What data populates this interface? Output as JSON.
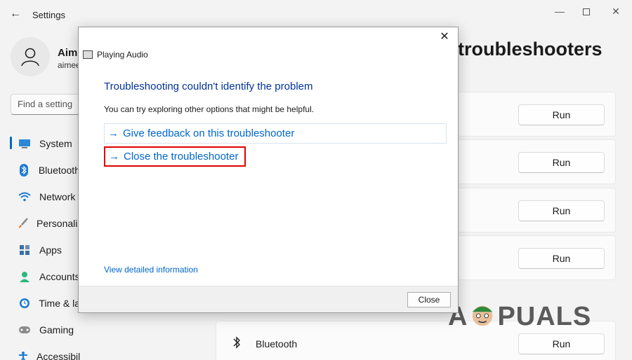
{
  "window": {
    "title": "Settings",
    "back_glyph": "←",
    "minimize_glyph": "—",
    "close_glyph": "✕"
  },
  "profile": {
    "name": "Aime",
    "email": "aimee"
  },
  "search": {
    "placeholder": "Find a setting"
  },
  "sidebar": {
    "items": [
      {
        "label": "System",
        "icon": "monitor-icon",
        "active": true
      },
      {
        "label": "Bluetooth",
        "icon": "bluetooth-icon"
      },
      {
        "label": "Network",
        "icon": "wifi-icon"
      },
      {
        "label": "Personaliz",
        "icon": "brush-icon"
      },
      {
        "label": "Apps",
        "icon": "apps-icon"
      },
      {
        "label": "Accounts",
        "icon": "person-icon"
      },
      {
        "label": "Time & la",
        "icon": "clock-icon"
      },
      {
        "label": "Gaming",
        "icon": "controller-icon"
      },
      {
        "label": "Accessibility",
        "icon": "accessibility-icon"
      }
    ]
  },
  "main": {
    "title": "troubleshooters",
    "run_label": "Run",
    "bluetooth_row_label": "Bluetooth"
  },
  "dialog": {
    "close_glyph": "✕",
    "app_title": "Playing Audio",
    "heading": "Troubleshooting couldn't identify the problem",
    "subtext": "You can try exploring other options that might be helpful.",
    "options": [
      {
        "arrow": "→",
        "label": "Give feedback on this troubleshooter"
      },
      {
        "arrow": "→",
        "label": "Close the troubleshooter"
      }
    ],
    "detail_link": "View detailed information",
    "close_button": "Close"
  },
  "watermark": {
    "text_left": "A",
    "text_right": "PUALS"
  },
  "colors": {
    "accent": "#0067c0",
    "link": "#0066cc",
    "heading": "#003399",
    "highlight": "#e00000"
  }
}
